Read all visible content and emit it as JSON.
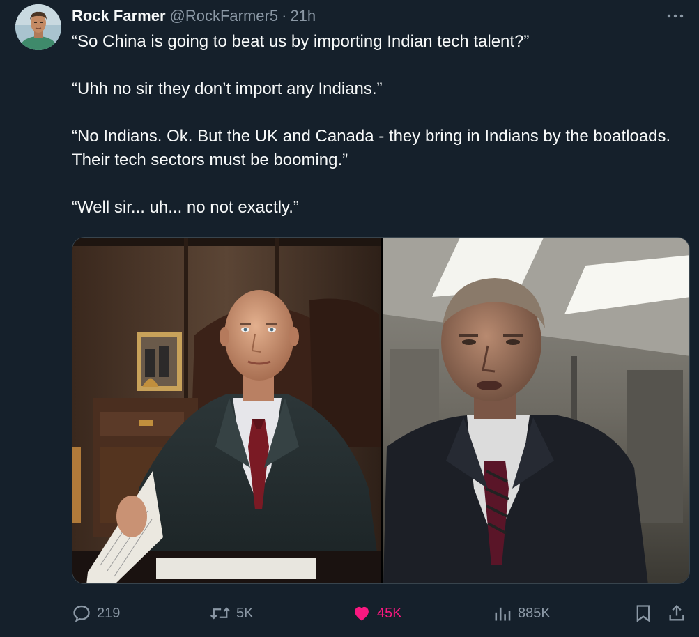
{
  "tweet": {
    "display_name": "Rock Farmer",
    "handle": "@RockFarmer5",
    "separator": "·",
    "time": "21h",
    "paragraphs": [
      "“So China is going to beat us by importing Indian tech talent?”",
      "“Uhh no sir they don’t import any Indians.”",
      "“No Indians. Ok. But the UK and Canada - they bring in Indians by the boatloads. Their tech sectors must be booming.”",
      "“Well sir... uh... no not exactly.”"
    ]
  },
  "media": {
    "left_photo": "photo",
    "right_photo": "photo"
  },
  "actions": {
    "replies": "219",
    "reposts": "5K",
    "likes": "45K",
    "views": "885K",
    "reply_icon": "reply-icon",
    "repost_icon": "repost-icon",
    "like_icon": "heart-icon",
    "views_icon": "views-icon",
    "bookmark_icon": "bookmark-icon",
    "share_icon": "share-icon"
  },
  "colors": {
    "background": "#15202b",
    "text_primary": "#f7f9f9",
    "text_secondary": "#8b98a5",
    "like_active": "#f91880",
    "border": "#38444d"
  }
}
